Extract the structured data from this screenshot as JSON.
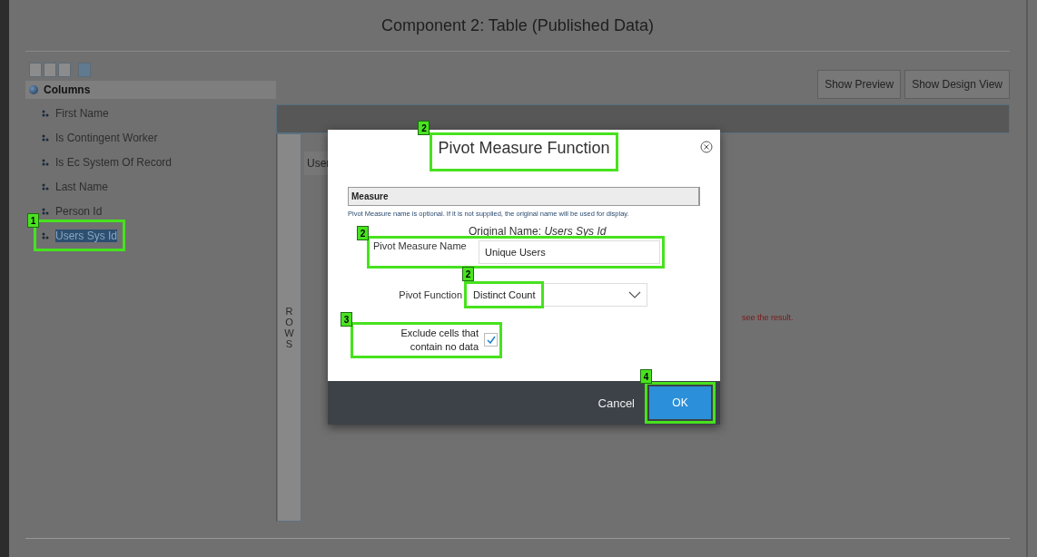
{
  "window": {
    "title": "Component 2: Table (Published Data)"
  },
  "sidebar": {
    "header": "Columns",
    "items": [
      {
        "label": "First Name",
        "selected": false
      },
      {
        "label": "Is Contingent Worker",
        "selected": false
      },
      {
        "label": "Is Ec System Of Record",
        "selected": false
      },
      {
        "label": "Last Name",
        "selected": false
      },
      {
        "label": "Person Id",
        "selected": false
      },
      {
        "label": "Users Sys Id",
        "selected": true,
        "callout": "1"
      }
    ]
  },
  "view_buttons": [
    "Show Preview",
    "Show Design View"
  ],
  "rows_label": "ROWS",
  "table": {
    "cell": "User"
  },
  "message": "see the result.",
  "dialog": {
    "title": "Pivot Measure Function",
    "title_callout": "2",
    "section": "Measure",
    "hint": "Pivot Measure name is optional. If it is not supplied, the original name will be used for display.",
    "original_name": "Original Name: *Users Sys Id*",
    "name_field": {
      "label": "Pivot Measure Name",
      "value": "Unique Users",
      "callout": "2"
    },
    "function_field": {
      "label": "Pivot Function",
      "value": "Distinct Count",
      "callout": "2"
    },
    "exclude": {
      "label": "Exclude cells that contain no data",
      "checked": true,
      "callout": "3"
    },
    "cancel": "Cancel",
    "ok": {
      "label": "OK",
      "callout": "4"
    }
  }
}
